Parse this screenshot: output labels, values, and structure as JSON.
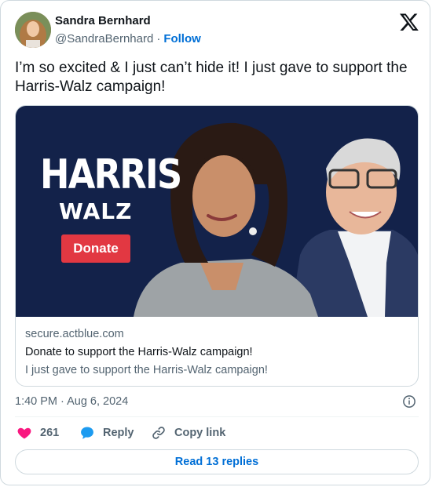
{
  "author": {
    "name": "Sandra Bernhard",
    "handle": "@SandraBernhard",
    "separator": "·",
    "follow_label": "Follow"
  },
  "tweet": {
    "text": "I’m so excited & I just can’t hide it! I just gave to support the Harris-Walz campaign!"
  },
  "link_card": {
    "hero_title": "HARRIS",
    "hero_subtitle": "WALZ",
    "hero_button": "Donate",
    "domain": "secure.actblue.com",
    "title": "Donate to support the Harris-Walz campaign!",
    "description": "I just gave to support the Harris-Walz campaign!"
  },
  "footer": {
    "timestamp": "1:40 PM · Aug 6, 2024",
    "likes": "261",
    "reply_label": "Reply",
    "copy_link_label": "Copy link",
    "read_replies_label": "Read 13 replies"
  },
  "colors": {
    "link_blue": "#006fd6",
    "heart_red": "#f91880",
    "donate_red": "#e23842",
    "hero_navy": "#13224a"
  },
  "icons": [
    "x-logo-icon",
    "info-icon",
    "heart-icon",
    "reply-bubble-icon",
    "link-icon"
  ]
}
